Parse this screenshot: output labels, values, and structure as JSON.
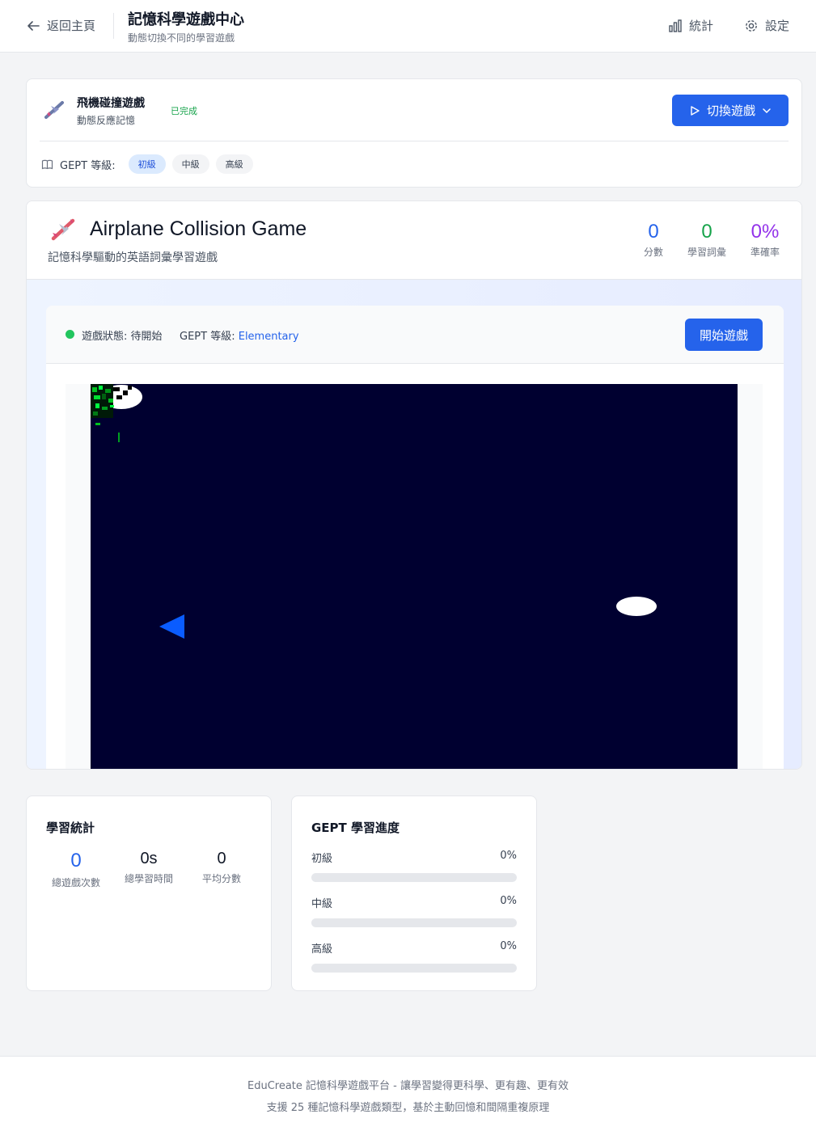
{
  "header": {
    "back_label": "返回主頁",
    "title": "記憶科學遊戲中心",
    "subtitle": "動態切換不同的學習遊戲",
    "stats_label": "統計",
    "settings_label": "設定"
  },
  "switcher": {
    "game_name": "飛機碰撞遊戲",
    "game_desc": "動態反應記憶",
    "done_badge": "已完成",
    "switch_label": "切換遊戲",
    "gept_label": "GEPT 等級:",
    "levels": [
      "初級",
      "中級",
      "高級"
    ],
    "active_level": "初級"
  },
  "game": {
    "title": "Airplane Collision Game",
    "subtitle": "記憶科學驅動的英語詞彙學習遊戲",
    "stats": {
      "score": "0",
      "score_label": "分數",
      "words": "0",
      "words_label": "學習詞彙",
      "accuracy": "0%",
      "accuracy_label": "準確率"
    },
    "score_color": "#2563eb",
    "words_color": "#16a34a",
    "accuracy_color": "#9333ea",
    "status_label": "遊戲狀態: 待開始",
    "gept_label": "GEPT 等級:",
    "gept_value": "Elementary",
    "start_label": "開始遊戲"
  },
  "learning_stats": {
    "title": "學習統計",
    "total_games": "0",
    "total_games_label": "總遊戲次數",
    "total_time": "0s",
    "total_time_label": "總學習時間",
    "avg_score": "0",
    "avg_score_label": "平均分數"
  },
  "gept_progress": {
    "title": "GEPT 學習進度",
    "rows": [
      {
        "label": "初級",
        "value": "0%",
        "fraction": 0
      },
      {
        "label": "中級",
        "value": "0%",
        "fraction": 0
      },
      {
        "label": "高級",
        "value": "0%",
        "fraction": 0
      }
    ]
  },
  "footer": {
    "line1": "EduCreate 記憶科學遊戲平台 - 讓學習變得更科學、更有趣、更有效",
    "line2": "支援 25 種記憶科學遊戲類型，基於主動回憶和間隔重複原理"
  },
  "icons": [
    "arrow-left-icon",
    "bar-chart-icon",
    "gear-icon",
    "airplane-icon",
    "play-icon",
    "chevron-down-icon",
    "book-icon"
  ],
  "colors": {
    "accent": "#2563eb",
    "canvas_bg": "#000030",
    "player": "#0a5cff"
  }
}
